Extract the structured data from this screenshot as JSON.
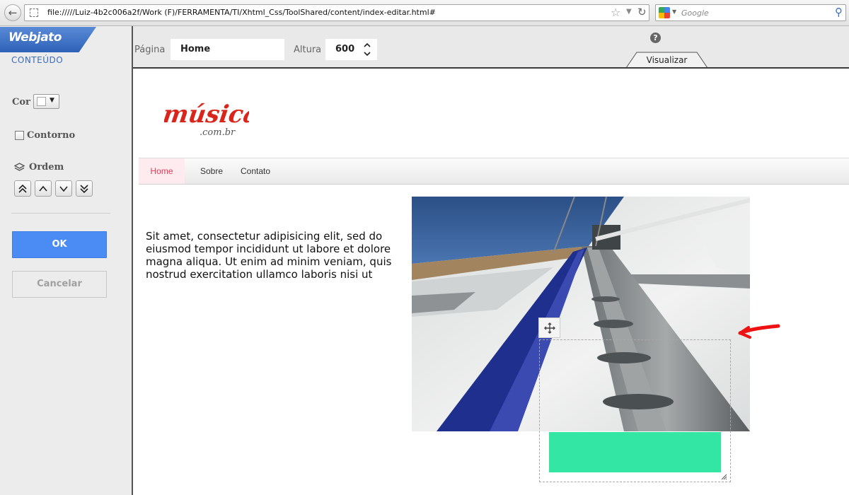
{
  "browser": {
    "url": "file://///Luiz-4b2c006a2f/Work  (F)/FERRAMENTA/TI/Xhtml_Css/ToolShared/content/index-editar.html#",
    "search_placeholder": "Google"
  },
  "app": {
    "logo_text": "Webjato",
    "section_label": "CONTEÚDO"
  },
  "panel": {
    "cor_label": "Cor",
    "cor_value": "#ffffff",
    "contorno_label": "Contorno",
    "contorno_checked": false,
    "ordem_label": "Ordem",
    "ok_label": "OK",
    "cancel_label": "Cancelar"
  },
  "toolbar": {
    "pagina_label": "Página",
    "pagina_value": "Home",
    "altura_label": "Altura",
    "altura_value": "600",
    "visualizar_label": "Visualizar"
  },
  "site": {
    "logo_main": "música",
    "logo_sub": ".com.br",
    "nav": [
      "Home",
      "Sobre",
      "Contato"
    ],
    "body_text": "Sit amet, consectetur adipisicing elit, sed do eiusmod tempor incididunt ut  labore et dolore magna aliqua. Ut enim ad minim veniam, quis nostrud exercitation ullamco laboris nisi ut"
  },
  "colors": {
    "accent_blue": "#4b8bf4",
    "green_box": "#33e6a4",
    "nav_active": "#e03b56",
    "logo_red": "#d8261c"
  }
}
